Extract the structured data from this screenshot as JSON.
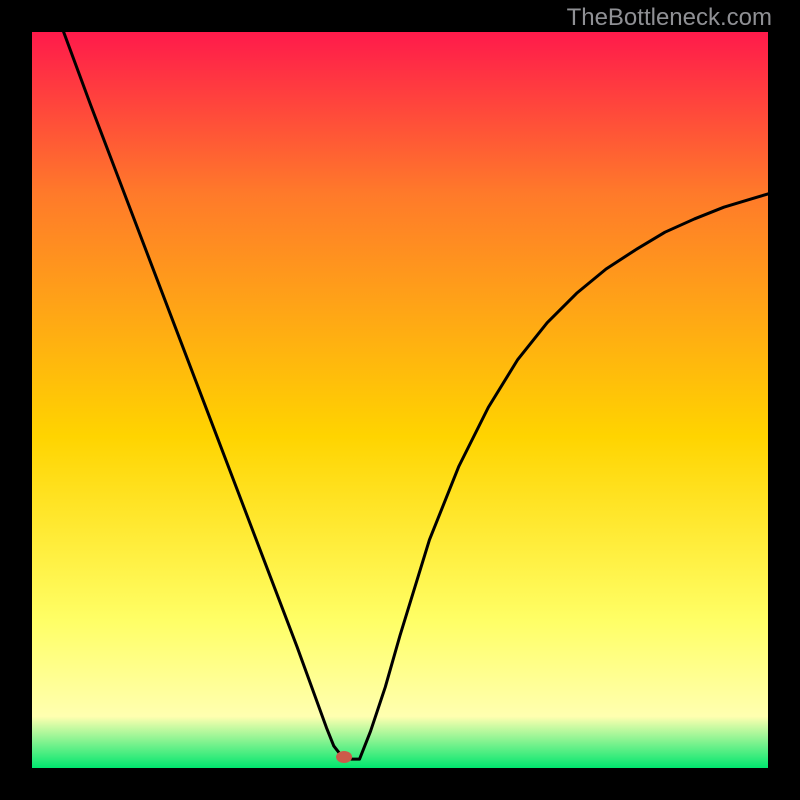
{
  "watermark": "TheBottleneck.com",
  "chart_data": {
    "type": "line",
    "title": "",
    "xlabel": "",
    "ylabel": "",
    "xlim": [
      0,
      100
    ],
    "ylim": [
      0,
      100
    ],
    "grid": false,
    "legend": false,
    "notes": "V-shaped bottleneck curve on a vertical rainbow gradient (red top → green bottom). Values are read from pixel positions: x is normalized 0–100 across plot width, y is % of plot height measured from bottom (0 = bottom, 100 = top).",
    "gradient_colors": {
      "top": "#ff1a4b",
      "upper_mid": "#ff7a2a",
      "mid": "#ffd400",
      "lower_mid": "#ffff66",
      "pale": "#ffffb0",
      "bottom": "#00e66e"
    },
    "marker": {
      "x": 42.4,
      "y": 1.5,
      "color": "#cc5a4a"
    },
    "series": [
      {
        "name": "left-branch",
        "x": [
          4.3,
          8,
          12,
          16,
          20,
          24,
          28,
          32,
          36,
          38,
          40,
          41,
          42.4
        ],
        "y": [
          100,
          90,
          79.5,
          69,
          58.5,
          48,
          37.5,
          27,
          16.5,
          11,
          5.5,
          3,
          1.2
        ]
      },
      {
        "name": "floor",
        "x": [
          42.4,
          44.5
        ],
        "y": [
          1.2,
          1.2
        ]
      },
      {
        "name": "right-branch",
        "x": [
          44.5,
          46,
          48,
          50,
          54,
          58,
          62,
          66,
          70,
          74,
          78,
          82,
          86,
          90,
          94,
          98,
          100
        ],
        "y": [
          1.2,
          5,
          11,
          18,
          31,
          41,
          49,
          55.5,
          60.5,
          64.5,
          67.8,
          70.4,
          72.8,
          74.6,
          76.2,
          77.4,
          78
        ]
      }
    ]
  }
}
